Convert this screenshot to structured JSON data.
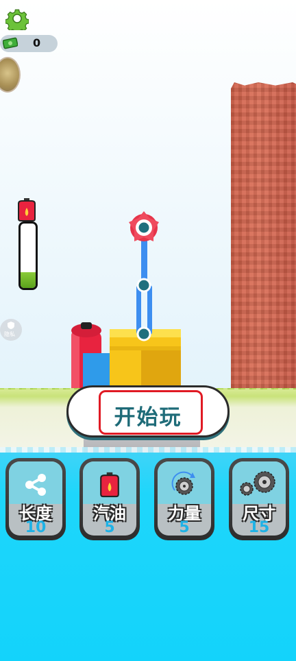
{
  "hud": {
    "money_value": "0",
    "fuel_level": 0.25,
    "privacy_label": "隐私"
  },
  "start_button": {
    "label": "开始玩"
  },
  "upgrades": [
    {
      "name": "长度",
      "value": "10",
      "icon": "share-node-icon"
    },
    {
      "name": "汽油",
      "value": "5",
      "icon": "gas-can-icon"
    },
    {
      "name": "力量",
      "value": "5",
      "icon": "saw-power-icon"
    },
    {
      "name": "尺寸",
      "value": "15",
      "icon": "saw-size-icon"
    }
  ],
  "colors": {
    "accent": "#1e6b78",
    "highlight_box": "#e01a24",
    "tower": "#cf5f48",
    "water": "#13d3fb",
    "upgrade_number": "#1fb2e6"
  }
}
